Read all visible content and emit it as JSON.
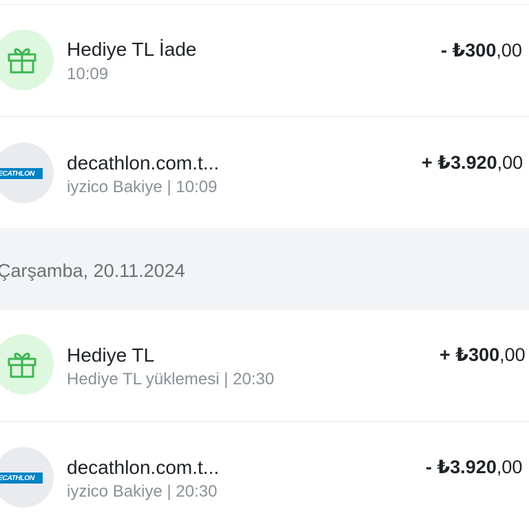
{
  "transactions_top": [
    {
      "icon": "gift-icon",
      "title": "Hediye TL İade",
      "subtitle": "10:09",
      "amount_sign": "- ",
      "amount_main": "₺300",
      "amount_decimal": ",00"
    },
    {
      "icon": "decathlon-logo",
      "logo_text": "DECATHLON",
      "title": "decathlon.com.t...",
      "subtitle": "iyzico Bakiye | 10:09",
      "amount_sign": "+ ",
      "amount_main": "₺3.920",
      "amount_decimal": ",00"
    }
  ],
  "date_header": "Çarşamba, 20.11.2024",
  "transactions_bottom": [
    {
      "icon": "gift-icon",
      "title": "Hediye TL",
      "subtitle": "Hediye TL yüklemesi | 20:30",
      "amount_sign": "+ ",
      "amount_main": "₺300",
      "amount_decimal": ",00"
    },
    {
      "icon": "decathlon-logo",
      "logo_text": "DECATHLON",
      "title": "decathlon.com.t...",
      "subtitle": "iyzico Bakiye | 20:30",
      "amount_sign": "- ",
      "amount_main": "₺3.920",
      "amount_decimal": ",00"
    }
  ],
  "colors": {
    "gift_bg": "#def7df",
    "gift_stroke": "#3fb552",
    "brand_bg": "#e9ebee",
    "brand_blue": "#0082c3",
    "divider": "#e6e8eb",
    "date_bg": "#f3f4f6"
  }
}
